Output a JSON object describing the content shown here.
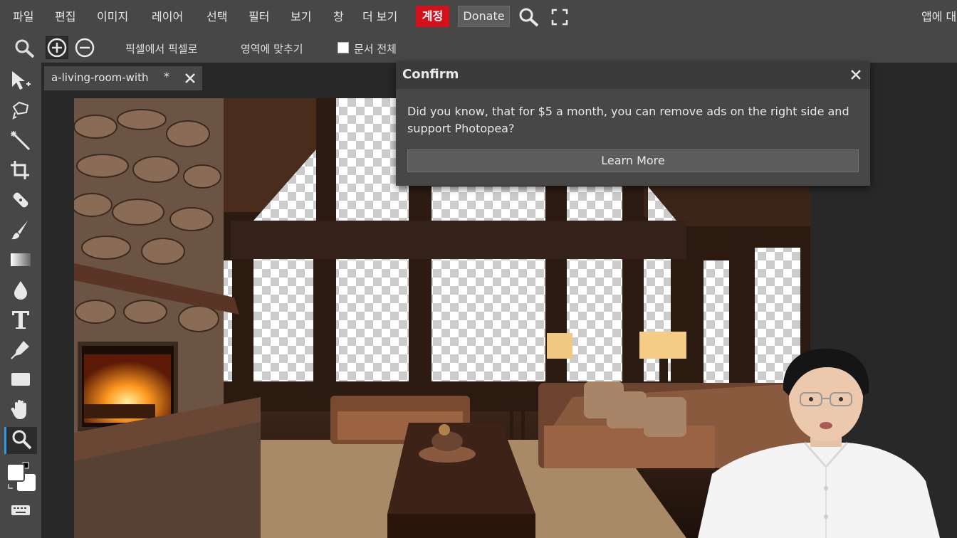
{
  "menu": {
    "items": [
      "파일",
      "편집",
      "이미지",
      "레이어",
      "선택",
      "필터",
      "보기",
      "창",
      "더 보기"
    ],
    "account": "계정",
    "donate": "Donate",
    "right_label": "앱에 대"
  },
  "options": {
    "pixel_to_pixel": "픽셀에서 픽셀로",
    "fit_area": "영역에 맞추기",
    "whole_document": "문서 전체",
    "whole_document_checked": false
  },
  "document_tab": {
    "name": "a-living-room-with",
    "modified_marker": "*"
  },
  "dialog": {
    "title": "Confirm",
    "message": "Did you know, that for $5 a month, you can remove ads on the right side and support Photopea?",
    "button": "Learn More"
  },
  "colors": {
    "menu_bg": "#474747",
    "workspace_bg": "#282828",
    "account_red": "#d4101a",
    "active_tool_accent": "#2f9be6"
  },
  "icons": [
    "search-icon",
    "zoom-in-icon",
    "zoom-out-icon",
    "fullscreen-icon",
    "close-icon",
    "move-tool-icon",
    "lasso-tool-icon",
    "magic-wand-icon",
    "crop-icon",
    "healing-icon",
    "brush-icon",
    "gradient-icon",
    "blur-icon",
    "type-icon",
    "pen-icon",
    "rectangle-icon",
    "hand-icon",
    "zoom-tool-icon",
    "color-swatch-icon",
    "keyboard-icon"
  ]
}
